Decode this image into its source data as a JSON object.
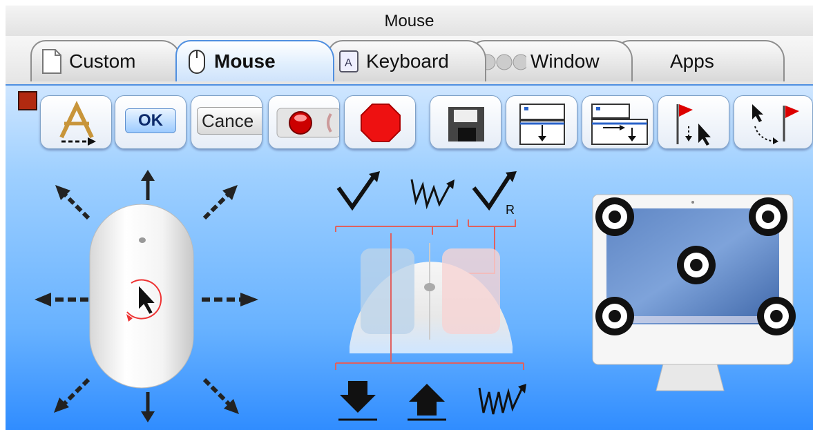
{
  "window": {
    "title": "Mouse"
  },
  "tabs": [
    {
      "label": "Custom",
      "active": false,
      "icon": "document-icon"
    },
    {
      "label": "Mouse",
      "active": true,
      "icon": "mouse-icon"
    },
    {
      "label": "Keyboard",
      "active": false,
      "icon": "keyboard-key-icon"
    },
    {
      "label": "Window",
      "active": false,
      "icon": "window-buttons-icon"
    },
    {
      "label": "Apps",
      "active": false,
      "icon": ""
    }
  ],
  "toolbar": {
    "record_indicator_color": "#b12a10",
    "buttons": [
      {
        "name": "launch-app",
        "icon": "applications-launch-icon"
      },
      {
        "name": "ok",
        "label": "OK"
      },
      {
        "name": "cancel",
        "label": "Cance"
      },
      {
        "name": "radio-record",
        "icon": "red-radio-icon"
      },
      {
        "name": "stop",
        "icon": "stop-sign-icon"
      },
      {
        "name": "save",
        "icon": "floppy-disk-icon"
      },
      {
        "name": "window-move-down",
        "icon": "window-arrow-down-icon"
      },
      {
        "name": "window-move-right-down",
        "icon": "window-arrow-right-down-icon"
      },
      {
        "name": "flag-cursor",
        "icon": "flag-to-cursor-icon"
      },
      {
        "name": "cursor-flag",
        "icon": "cursor-to-flag-icon"
      }
    ]
  },
  "mouse_panel": {
    "move_directions": [
      "up-left",
      "up",
      "up-right",
      "left",
      "right",
      "down-left",
      "down",
      "down-right"
    ],
    "click_actions": [
      "click",
      "double-click",
      "right-click"
    ],
    "right_click_suffix": "R",
    "button_actions": [
      "press-down",
      "release-up",
      "multi-click"
    ],
    "screen_targets": [
      "top-left",
      "top-right",
      "center",
      "bottom-left",
      "bottom-right"
    ]
  }
}
